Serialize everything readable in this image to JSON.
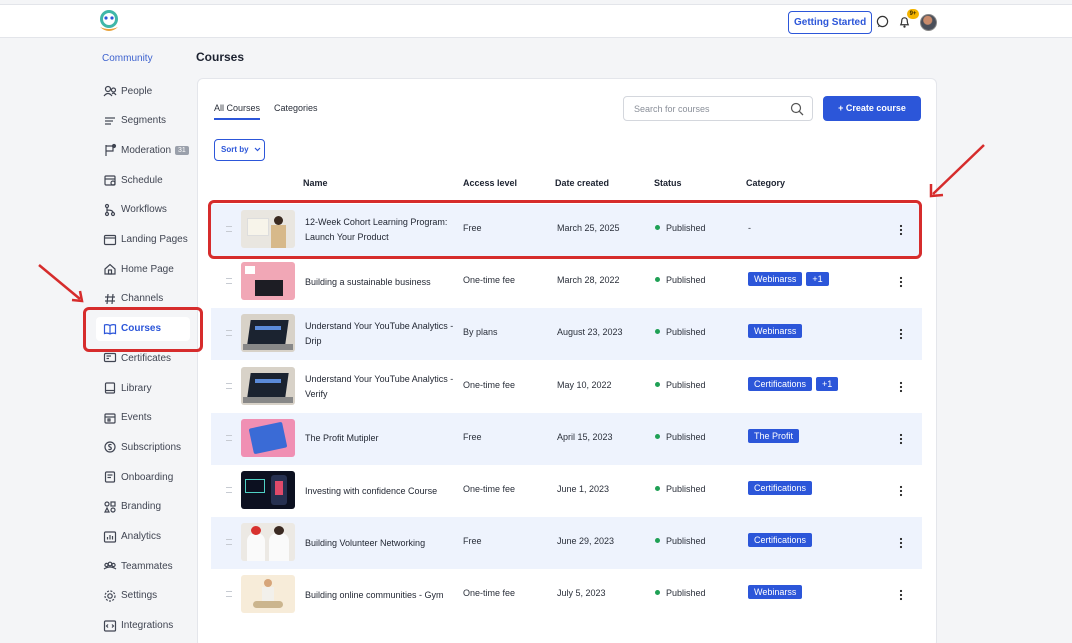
{
  "header": {
    "getting_started": "Getting Started",
    "notif_badge": "9+"
  },
  "sidebar": {
    "heading": "Community",
    "items": [
      {
        "label": "People",
        "icon": "people-icon"
      },
      {
        "label": "Segments",
        "icon": "segments-icon"
      },
      {
        "label": "Moderation",
        "icon": "moderation-icon",
        "count": "31"
      },
      {
        "label": "Schedule",
        "icon": "schedule-icon"
      },
      {
        "label": "Workflows",
        "icon": "workflows-icon"
      },
      {
        "label": "Landing Pages",
        "icon": "landing-pages-icon"
      },
      {
        "label": "Home Page",
        "icon": "home-icon"
      },
      {
        "label": "Channels",
        "icon": "hash-icon"
      },
      {
        "label": "Courses",
        "icon": "book-icon",
        "active": true
      },
      {
        "label": "Certificates",
        "icon": "certificate-icon"
      },
      {
        "label": "Library",
        "icon": "library-icon"
      },
      {
        "label": "Events",
        "icon": "events-icon"
      },
      {
        "label": "Subscriptions",
        "icon": "subscriptions-icon"
      },
      {
        "label": "Onboarding",
        "icon": "onboarding-icon"
      },
      {
        "label": "Branding",
        "icon": "branding-icon"
      },
      {
        "label": "Analytics",
        "icon": "analytics-icon"
      },
      {
        "label": "Teammates",
        "icon": "teammates-icon"
      },
      {
        "label": "Settings",
        "icon": "gear-icon"
      },
      {
        "label": "Integrations",
        "icon": "integrations-icon"
      }
    ]
  },
  "page": {
    "title": "Courses",
    "tabs": [
      "All Courses",
      "Categories"
    ],
    "search_placeholder": "Search for courses",
    "create_label": "+ Create course",
    "sort_label": "Sort by"
  },
  "table": {
    "columns": [
      "Name",
      "Access level",
      "Date created",
      "Status",
      "Category"
    ],
    "rows": [
      {
        "name": "12-Week Cohort Learning Program: Launch Your Product",
        "access": "Free",
        "date": "March 25, 2025",
        "status": "Published",
        "categories": [],
        "category_text": "-",
        "thumb": "presenter"
      },
      {
        "name": "Building a sustainable business",
        "access": "One-time fee",
        "date": "March 28, 2022",
        "status": "Published",
        "categories": [
          "Webinarss",
          "+1"
        ],
        "thumb": "desk-pink"
      },
      {
        "name": "Understand Your YouTube Analytics - Drip",
        "access": "By plans",
        "date": "August 23, 2023",
        "status": "Published",
        "categories": [
          "Webinarss"
        ],
        "thumb": "laptop"
      },
      {
        "name": "Understand Your YouTube Analytics - Verify",
        "access": "One-time fee",
        "date": "May 10, 2022",
        "status": "Published",
        "categories": [
          "Certifications",
          "+1"
        ],
        "thumb": "laptop"
      },
      {
        "name": "The Profit Mutipler",
        "access": "Free",
        "date": "April 15, 2023",
        "status": "Published",
        "categories": [
          "The Profit"
        ],
        "thumb": "pink-tablet"
      },
      {
        "name": "Investing with confidence Course",
        "access": "One-time fee",
        "date": "June 1, 2023",
        "status": "Published",
        "categories": [
          "Certifications"
        ],
        "thumb": "charts"
      },
      {
        "name": "Building Volunteer Networking",
        "access": "Free",
        "date": "June 29, 2023",
        "status": "Published",
        "categories": [
          "Certifications"
        ],
        "thumb": "volunteers"
      },
      {
        "name": "Building online communities - Gym",
        "access": "One-time fee",
        "date": "July 5, 2023",
        "status": "Published",
        "categories": [
          "Webinarss"
        ],
        "thumb": "yoga"
      }
    ]
  },
  "colors": {
    "accent": "#2c56d9",
    "published": "#1fa055",
    "annotation": "#d62c2c"
  }
}
